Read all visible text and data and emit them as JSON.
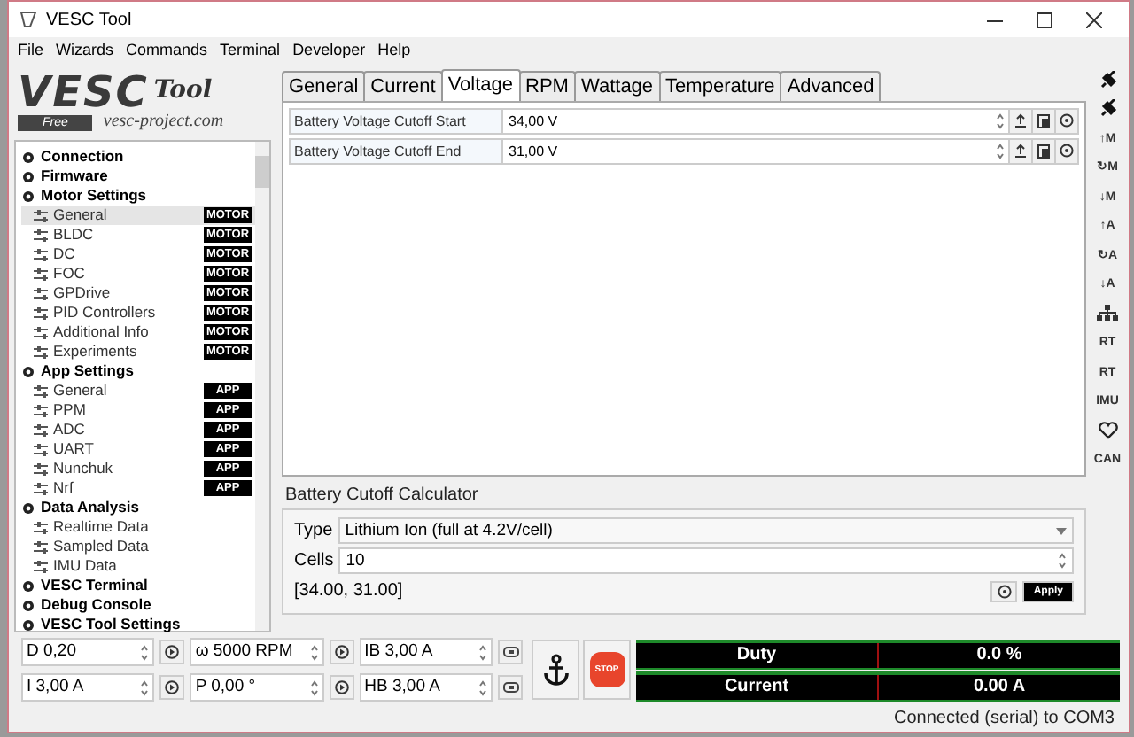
{
  "window": {
    "title": "VESC Tool"
  },
  "menu": [
    "File",
    "Wizards",
    "Commands",
    "Terminal",
    "Developer",
    "Help"
  ],
  "logo": {
    "name": "VESC",
    "product": "Tool",
    "tagline": "Free",
    "site": "vesc-project.com"
  },
  "sidebar": {
    "items": [
      {
        "label": "Connection",
        "selected": false
      },
      {
        "label": "Firmware",
        "selected": false
      },
      {
        "label": "Motor Settings",
        "selected": false,
        "children": [
          {
            "label": "General",
            "badge": "MOTOR",
            "selected": true
          },
          {
            "label": "BLDC",
            "badge": "MOTOR",
            "selected": false
          },
          {
            "label": "DC",
            "badge": "MOTOR",
            "selected": false
          },
          {
            "label": "FOC",
            "badge": "MOTOR",
            "selected": false
          },
          {
            "label": "GPDrive",
            "badge": "MOTOR",
            "selected": false
          },
          {
            "label": "PID Controllers",
            "badge": "MOTOR",
            "selected": false
          },
          {
            "label": "Additional Info",
            "badge": "MOTOR",
            "selected": false
          },
          {
            "label": "Experiments",
            "badge": "MOTOR",
            "selected": false
          }
        ]
      },
      {
        "label": "App Settings",
        "selected": false,
        "children": [
          {
            "label": "General",
            "badge": "APP",
            "selected": false
          },
          {
            "label": "PPM",
            "badge": "APP",
            "selected": false
          },
          {
            "label": "ADC",
            "badge": "APP",
            "selected": false
          },
          {
            "label": "UART",
            "badge": "APP",
            "selected": false
          },
          {
            "label": "Nunchuk",
            "badge": "APP",
            "selected": false
          },
          {
            "label": "Nrf",
            "badge": "APP",
            "selected": false
          }
        ]
      },
      {
        "label": "Data Analysis",
        "selected": false,
        "children": [
          {
            "label": "Realtime Data",
            "selected": false
          },
          {
            "label": "Sampled Data",
            "selected": false
          },
          {
            "label": "IMU Data",
            "selected": false
          }
        ]
      },
      {
        "label": "VESC Terminal",
        "selected": false
      },
      {
        "label": "Debug Console",
        "selected": false
      },
      {
        "label": "VESC Tool Settings",
        "selected": false
      }
    ]
  },
  "tabs": [
    {
      "label": "General",
      "selected": false
    },
    {
      "label": "Current",
      "selected": false
    },
    {
      "label": "Voltage",
      "selected": true
    },
    {
      "label": "RPM",
      "selected": false
    },
    {
      "label": "Wattage",
      "selected": false
    },
    {
      "label": "Temperature",
      "selected": false
    },
    {
      "label": "Advanced",
      "selected": false
    }
  ],
  "parameters": [
    {
      "label": "Battery Voltage Cutoff Start",
      "value": "34,00 V"
    },
    {
      "label": "Battery Voltage Cutoff End",
      "value": "31,00 V"
    }
  ],
  "calculator": {
    "title": "Battery Cutoff Calculator",
    "type_label": "Type",
    "type_value": "Lithium Ion (full at 4.2V/cell)",
    "cells_label": "Cells",
    "cells_value": "10",
    "result": "[34.00, 31.00]",
    "apply": "Apply"
  },
  "controls": [
    {
      "value": "D 0,20",
      "kind": "play"
    },
    {
      "value": "ω 5000 RPM",
      "kind": "play"
    },
    {
      "value": "IB 3,00 A",
      "kind": "brake"
    },
    {
      "value": "I 3,00 A",
      "kind": "play"
    },
    {
      "value": "P 0,00 °",
      "kind": "play"
    },
    {
      "value": "HB 3,00 A",
      "kind": "brake"
    }
  ],
  "stop": "STOP",
  "gauges": [
    {
      "label": "Duty",
      "value": "0.0 %"
    },
    {
      "label": "Current",
      "value": "0.00 A"
    }
  ],
  "toolbar": [
    {
      "kind": "plug"
    },
    {
      "kind": "plug"
    },
    {
      "kind": "text",
      "label": "↑M"
    },
    {
      "kind": "text",
      "label": "↻M"
    },
    {
      "kind": "text",
      "label": "↓M"
    },
    {
      "kind": "text",
      "label": "↑A"
    },
    {
      "kind": "text",
      "label": "↻A"
    },
    {
      "kind": "text",
      "label": "↓A"
    },
    {
      "kind": "nodes"
    },
    {
      "kind": "text",
      "label": "RT"
    },
    {
      "kind": "text",
      "label": "RT"
    },
    {
      "kind": "text",
      "label": "IMU"
    },
    {
      "kind": "heart"
    },
    {
      "kind": "text",
      "label": "CAN"
    }
  ],
  "status_bar": "Connected (serial) to COM3"
}
